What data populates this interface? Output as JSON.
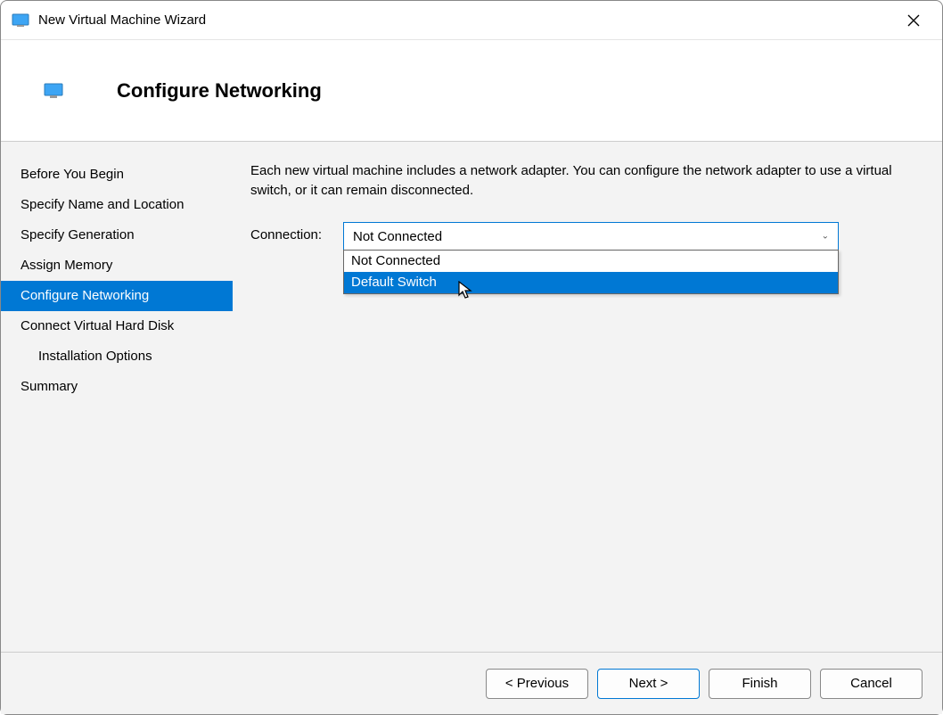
{
  "window": {
    "title": "New Virtual Machine Wizard"
  },
  "header": {
    "title": "Configure Networking"
  },
  "sidebar": {
    "items": [
      {
        "label": "Before You Begin"
      },
      {
        "label": "Specify Name and Location"
      },
      {
        "label": "Specify Generation"
      },
      {
        "label": "Assign Memory"
      },
      {
        "label": "Configure Networking"
      },
      {
        "label": "Connect Virtual Hard Disk"
      },
      {
        "label": "Installation Options"
      },
      {
        "label": "Summary"
      }
    ]
  },
  "content": {
    "description": "Each new virtual machine includes a network adapter. You can configure the network adapter to use a virtual switch, or it can remain disconnected.",
    "connection_label": "Connection:",
    "connection_selected": "Not Connected",
    "connection_options": [
      "Not Connected",
      "Default Switch"
    ]
  },
  "buttons": {
    "previous": "< Previous",
    "next": "Next >",
    "finish": "Finish",
    "cancel": "Cancel"
  }
}
